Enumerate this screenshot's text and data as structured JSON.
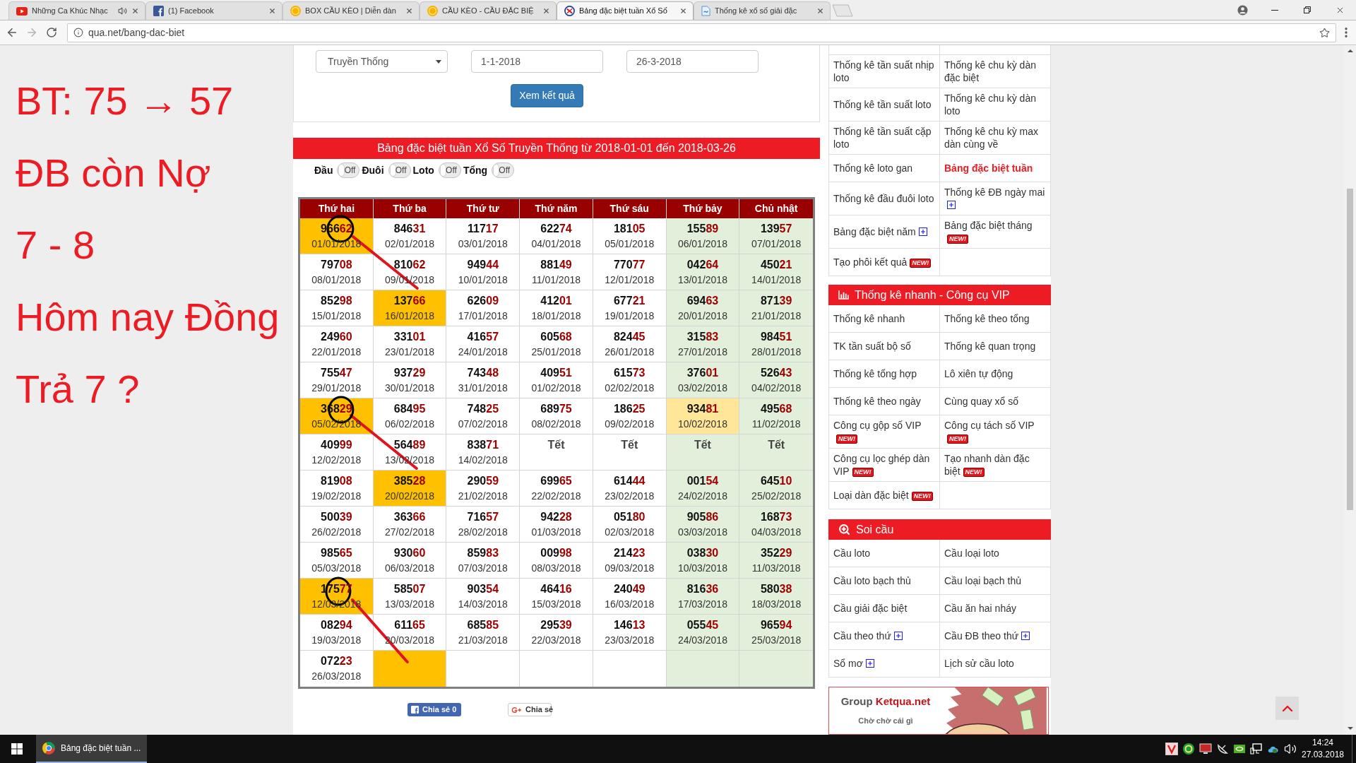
{
  "browser": {
    "tabs": [
      {
        "title": "Những Ca Khúc Nhạc",
        "selected": false,
        "audible": true
      },
      {
        "title": "(1) Facebook",
        "selected": false,
        "audible": false
      },
      {
        "title": "BOX CẦU KÈO | Diễn đàn",
        "selected": false,
        "audible": false
      },
      {
        "title": "CẦU KÈO - CẦU ĐẶC BIỆ",
        "selected": false,
        "audible": false
      },
      {
        "title": "Bảng đặc biệt tuần Xổ Số",
        "selected": true,
        "audible": false
      },
      {
        "title": "Thống kê xổ số giải đặc",
        "selected": false,
        "audible": false
      }
    ],
    "address": "qua.net/bang-dac-biet"
  },
  "annotations": [
    "BT: 75 → 57",
    "ĐB còn Nợ",
    "7 - 8",
    "Hôm nay Đồng",
    "Trả 7 ?"
  ],
  "filter_form": {
    "lottery_select": {
      "value": "Truyền Thống"
    },
    "start_date": {
      "value": "1-1-2018"
    },
    "end_date": {
      "value": "26-3-2018"
    },
    "submit_label": "Xem kết quả"
  },
  "results": {
    "heading": "Bảng đặc biệt tuần Xổ Số Truyền Thống từ 2018-01-01 đến 2018-03-26",
    "toggles": [
      {
        "label": "Đầu",
        "switch_text": "Off",
        "on": false
      },
      {
        "label": "Đuôi",
        "switch_text": "Off",
        "on": false
      },
      {
        "label": "Loto",
        "switch_text": "Off",
        "on": false
      },
      {
        "label": "Tổng",
        "switch_text": "Off",
        "on": false
      }
    ],
    "table": {
      "columns": [
        {
          "label": "Thứ hai",
          "weekend": false
        },
        {
          "label": "Thứ ba",
          "weekend": false
        },
        {
          "label": "Thứ tư",
          "weekend": false
        },
        {
          "label": "Thứ năm",
          "weekend": false
        },
        {
          "label": "Thứ sáu",
          "weekend": false
        },
        {
          "label": "Thứ bảy",
          "weekend": true
        },
        {
          "label": "Chủ nhật",
          "weekend": true
        }
      ],
      "rows": [
        {
          "cells": [
            {
              "kind": "result",
              "number": "96662",
              "date": "01/01/2018",
              "color": "#ffc000"
            },
            {
              "kind": "result",
              "number": "84631",
              "date": "02/01/2018"
            },
            {
              "kind": "result",
              "number": "11717",
              "date": "03/01/2018"
            },
            {
              "kind": "result",
              "number": "62274",
              "date": "04/01/2018"
            },
            {
              "kind": "result",
              "number": "18105",
              "date": "05/01/2018"
            },
            {
              "kind": "result",
              "number": "15589",
              "date": "06/01/2018"
            },
            {
              "kind": "result",
              "number": "13957",
              "date": "07/01/2018"
            }
          ]
        },
        {
          "cells": [
            {
              "kind": "result",
              "number": "79708",
              "date": "08/01/2018"
            },
            {
              "kind": "result",
              "number": "81062",
              "date": "09/01/2018"
            },
            {
              "kind": "result",
              "number": "94944",
              "date": "10/01/2018"
            },
            {
              "kind": "result",
              "number": "88149",
              "date": "11/01/2018"
            },
            {
              "kind": "result",
              "number": "77077",
              "date": "12/01/2018"
            },
            {
              "kind": "result",
              "number": "04264",
              "date": "13/01/2018"
            },
            {
              "kind": "result",
              "number": "45021",
              "date": "14/01/2018"
            }
          ]
        },
        {
          "cells": [
            {
              "kind": "result",
              "number": "85298",
              "date": "15/01/2018"
            },
            {
              "kind": "result",
              "number": "13766",
              "date": "16/01/2018",
              "color": "#ffc000"
            },
            {
              "kind": "result",
              "number": "62609",
              "date": "17/01/2018"
            },
            {
              "kind": "result",
              "number": "41201",
              "date": "18/01/2018"
            },
            {
              "kind": "result",
              "number": "67721",
              "date": "19/01/2018"
            },
            {
              "kind": "result",
              "number": "69463",
              "date": "20/01/2018"
            },
            {
              "kind": "result",
              "number": "87139",
              "date": "21/01/2018"
            }
          ]
        },
        {
          "cells": [
            {
              "kind": "result",
              "number": "24960",
              "date": "22/01/2018"
            },
            {
              "kind": "result",
              "number": "33101",
              "date": "23/01/2018"
            },
            {
              "kind": "result",
              "number": "41657",
              "date": "24/01/2018"
            },
            {
              "kind": "result",
              "number": "60568",
              "date": "25/01/2018"
            },
            {
              "kind": "result",
              "number": "82445",
              "date": "26/01/2018"
            },
            {
              "kind": "result",
              "number": "31583",
              "date": "27/01/2018"
            },
            {
              "kind": "result",
              "number": "98451",
              "date": "28/01/2018"
            }
          ]
        },
        {
          "cells": [
            {
              "kind": "result",
              "number": "75547",
              "date": "29/01/2018"
            },
            {
              "kind": "result",
              "number": "93729",
              "date": "30/01/2018"
            },
            {
              "kind": "result",
              "number": "74348",
              "date": "31/01/2018"
            },
            {
              "kind": "result",
              "number": "40951",
              "date": "01/02/2018"
            },
            {
              "kind": "result",
              "number": "61573",
              "date": "02/02/2018"
            },
            {
              "kind": "result",
              "number": "37601",
              "date": "03/02/2018"
            },
            {
              "kind": "result",
              "number": "52643",
              "date": "04/02/2018"
            }
          ]
        },
        {
          "cells": [
            {
              "kind": "result",
              "number": "36829",
              "date": "05/02/2018",
              "color": "#ffc000"
            },
            {
              "kind": "result",
              "number": "68495",
              "date": "06/02/2018"
            },
            {
              "kind": "result",
              "number": "74825",
              "date": "07/02/2018"
            },
            {
              "kind": "result",
              "number": "68975",
              "date": "08/02/2018"
            },
            {
              "kind": "result",
              "number": "18625",
              "date": "09/02/2018"
            },
            {
              "kind": "result",
              "number": "93481",
              "date": "10/02/2018",
              "color": "#ffe699"
            },
            {
              "kind": "result",
              "number": "49568",
              "date": "11/02/2018"
            }
          ]
        },
        {
          "cells": [
            {
              "kind": "result",
              "number": "40999",
              "date": "12/02/2018"
            },
            {
              "kind": "result",
              "number": "56489",
              "date": "13/02/2018"
            },
            {
              "kind": "result",
              "number": "83871",
              "date": "14/02/2018"
            },
            {
              "kind": "holiday",
              "label": "Tết"
            },
            {
              "kind": "holiday",
              "label": "Tết"
            },
            {
              "kind": "holiday",
              "label": "Tết"
            },
            {
              "kind": "holiday",
              "label": "Tết"
            }
          ]
        },
        {
          "cells": [
            {
              "kind": "result",
              "number": "81908",
              "date": "19/02/2018"
            },
            {
              "kind": "result",
              "number": "38528",
              "date": "20/02/2018",
              "color": "#ffc000"
            },
            {
              "kind": "result",
              "number": "29059",
              "date": "21/02/2018"
            },
            {
              "kind": "result",
              "number": "69965",
              "date": "22/02/2018"
            },
            {
              "kind": "result",
              "number": "61444",
              "date": "23/02/2018"
            },
            {
              "kind": "result",
              "number": "00154",
              "date": "24/02/2018"
            },
            {
              "kind": "result",
              "number": "64510",
              "date": "25/02/2018"
            }
          ]
        },
        {
          "cells": [
            {
              "kind": "result",
              "number": "50039",
              "date": "26/02/2018"
            },
            {
              "kind": "result",
              "number": "36366",
              "date": "27/02/2018"
            },
            {
              "kind": "result",
              "number": "71657",
              "date": "28/02/2018"
            },
            {
              "kind": "result",
              "number": "94228",
              "date": "01/03/2018"
            },
            {
              "kind": "result",
              "number": "05180",
              "date": "02/03/2018"
            },
            {
              "kind": "result",
              "number": "90586",
              "date": "03/03/2018"
            },
            {
              "kind": "result",
              "number": "16873",
              "date": "04/03/2018"
            }
          ]
        },
        {
          "cells": [
            {
              "kind": "result",
              "number": "98565",
              "date": "05/03/2018"
            },
            {
              "kind": "result",
              "number": "93060",
              "date": "06/03/2018"
            },
            {
              "kind": "result",
              "number": "85983",
              "date": "07/03/2018"
            },
            {
              "kind": "result",
              "number": "00998",
              "date": "08/03/2018"
            },
            {
              "kind": "result",
              "number": "21423",
              "date": "09/03/2018"
            },
            {
              "kind": "result",
              "number": "03830",
              "date": "10/03/2018"
            },
            {
              "kind": "result",
              "number": "35229",
              "date": "11/03/2018"
            }
          ]
        },
        {
          "cells": [
            {
              "kind": "result",
              "number": "17577",
              "date": "12/03/2018",
              "color": "#ffc000"
            },
            {
              "kind": "result",
              "number": "58507",
              "date": "13/03/2018"
            },
            {
              "kind": "result",
              "number": "90354",
              "date": "14/03/2018"
            },
            {
              "kind": "result",
              "number": "46416",
              "date": "15/03/2018"
            },
            {
              "kind": "result",
              "number": "24049",
              "date": "16/03/2018"
            },
            {
              "kind": "result",
              "number": "81636",
              "date": "17/03/2018"
            },
            {
              "kind": "result",
              "number": "58038",
              "date": "18/03/2018"
            }
          ]
        },
        {
          "cells": [
            {
              "kind": "result",
              "number": "08294",
              "date": "19/03/2018"
            },
            {
              "kind": "result",
              "number": "61165",
              "date": "20/03/2018"
            },
            {
              "kind": "result",
              "number": "68585",
              "date": "21/03/2018"
            },
            {
              "kind": "result",
              "number": "29539",
              "date": "22/03/2018"
            },
            {
              "kind": "result",
              "number": "14613",
              "date": "23/03/2018"
            },
            {
              "kind": "result",
              "number": "05545",
              "date": "24/03/2018"
            },
            {
              "kind": "result",
              "number": "96594",
              "date": "25/03/2018"
            }
          ]
        },
        {
          "cells": [
            {
              "kind": "result",
              "number": "07223",
              "date": "26/03/2018"
            },
            {
              "kind": "empty",
              "color": "#ffc000"
            },
            {
              "kind": "empty"
            },
            {
              "kind": "empty"
            },
            {
              "kind": "empty"
            },
            {
              "kind": "empty"
            },
            {
              "kind": "empty"
            }
          ]
        }
      ]
    }
  },
  "share_buttons": [
    {
      "kind": "facebook",
      "label": "Chia sẻ 0"
    },
    {
      "kind": "google",
      "label": "Chia sẻ"
    }
  ],
  "sidebar": {
    "sections": [
      {
        "rows": [
          {
            "cells": [
              {
                "label": "Thống kê tần suất nhịp loto",
                "selected": false,
                "expandable": false
              },
              {
                "label": "Thống kê chu kỳ dàn đặc biệt",
                "selected": false,
                "expandable": false
              }
            ]
          },
          {
            "cells": [
              {
                "label": "Thống kê tần suất loto",
                "selected": false,
                "expandable": false
              },
              {
                "label": "Thống kê chu kỳ dàn loto",
                "selected": false,
                "expandable": false
              }
            ]
          },
          {
            "cells": [
              {
                "label": "Thống kê tần suất cặp loto",
                "selected": false,
                "expandable": false
              },
              {
                "label": "Thống kê chu kỳ max dàn cùng về",
                "selected": false,
                "expandable": false
              }
            ]
          },
          {
            "cells": [
              {
                "label": "Thống kê loto gan",
                "selected": false,
                "expandable": false
              },
              {
                "label": "Bảng đặc biệt tuần",
                "selected": true,
                "expandable": false
              }
            ]
          },
          {
            "cells": [
              {
                "label": "Thống kê đầu đuôi loto",
                "selected": false,
                "expandable": false
              },
              {
                "label": "Thống kê ĐB ngày mai",
                "selected": false,
                "expandable": true
              }
            ]
          },
          {
            "cells": [
              {
                "label": "Bảng đặc biệt năm",
                "selected": false,
                "expandable": true
              },
              {
                "label": "Bảng đặc biệt tháng",
                "selected": false,
                "expandable": false,
                "badge": "NEW!"
              }
            ]
          },
          {
            "cells": [
              {
                "label": "Tạo phôi kết quả",
                "selected": false,
                "expandable": false,
                "badge": "NEW!"
              }
            ]
          }
        ]
      },
      {
        "title": "Thống kê nhanh - Công cụ VIP",
        "rows": [
          {
            "cells": [
              {
                "label": "Thống kê nhanh",
                "selected": false,
                "expandable": false
              },
              {
                "label": "Thống kê theo tổng",
                "selected": false,
                "expandable": false
              }
            ]
          },
          {
            "cells": [
              {
                "label": "TK tần suất bộ số",
                "selected": false,
                "expandable": false
              },
              {
                "label": "Thống kê quan trọng",
                "selected": false,
                "expandable": false
              }
            ]
          },
          {
            "cells": [
              {
                "label": "Thống kê tổng hợp",
                "selected": false,
                "expandable": false
              },
              {
                "label": "Lô xiên tự động",
                "selected": false,
                "expandable": false
              }
            ]
          },
          {
            "cells": [
              {
                "label": "Thống kê theo ngày",
                "selected": false,
                "expandable": false
              },
              {
                "label": "Cùng quay xổ số",
                "selected": false,
                "expandable": false
              }
            ]
          },
          {
            "cells": [
              {
                "label": "Công cụ gộp số VIP",
                "selected": false,
                "expandable": false,
                "badge": "NEW!"
              },
              {
                "label": "Công cụ tách số VIP",
                "selected": false,
                "expandable": false,
                "badge": "NEW!"
              }
            ]
          },
          {
            "cells": [
              {
                "label": "Công cụ lọc ghép dàn VIP",
                "selected": false,
                "expandable": false,
                "badge": "NEW!"
              },
              {
                "label": "Tạo nhanh dàn đặc biệt",
                "selected": false,
                "expandable": false,
                "badge": "NEW!"
              }
            ]
          },
          {
            "cells": [
              {
                "label": "Loại dàn đặc biệt",
                "selected": false,
                "expandable": false,
                "badge": "NEW!"
              }
            ]
          }
        ]
      },
      {
        "title": "Soi cầu",
        "rows": [
          {
            "cells": [
              {
                "label": "Cầu loto",
                "selected": false,
                "expandable": false
              },
              {
                "label": "Cầu loại loto",
                "selected": false,
                "expandable": false
              }
            ]
          },
          {
            "cells": [
              {
                "label": "Cầu loto bạch thủ",
                "selected": false,
                "expandable": false
              },
              {
                "label": "Cầu loại bạch thủ",
                "selected": false,
                "expandable": false
              }
            ]
          },
          {
            "cells": [
              {
                "label": "Cầu giải đặc biệt",
                "selected": false,
                "expandable": false
              },
              {
                "label": "Cầu ăn hai nháy",
                "selected": false,
                "expandable": false
              }
            ]
          },
          {
            "cells": [
              {
                "label": "Cầu theo thứ",
                "selected": false,
                "expandable": true
              },
              {
                "label": "Cầu ĐB theo thứ",
                "selected": false,
                "expandable": true
              }
            ]
          },
          {
            "cells": [
              {
                "label": "Sổ mơ",
                "selected": false,
                "expandable": true
              },
              {
                "label": "Lịch sử cầu loto",
                "selected": false,
                "expandable": false
              }
            ]
          }
        ]
      }
    ],
    "banner": {
      "brand_lead": "Group",
      "brand_name": "Ketqua.net",
      "tagline": "Chờ chờ cái gì"
    }
  },
  "taskbar": {
    "window_button": {
      "title": "Bảng đặc biệt tuần ...",
      "selected": true
    },
    "clock": {
      "time": "14:24",
      "date": "27.03.2018"
    }
  }
}
